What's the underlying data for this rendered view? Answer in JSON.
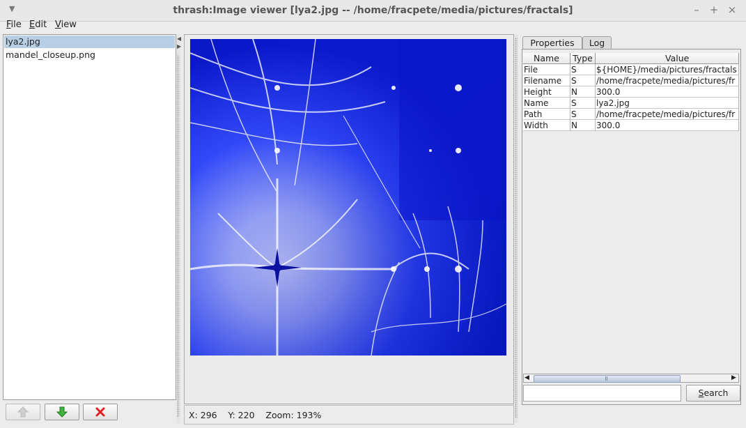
{
  "window": {
    "title": "thrash:Image viewer [lya2.jpg -- /home/fracpete/media/pictures/fractals]",
    "buttons": [
      "–",
      "+",
      "×"
    ]
  },
  "menubar": [
    {
      "accel": "F",
      "rest": "ile"
    },
    {
      "accel": "E",
      "rest": "dit"
    },
    {
      "accel": "V",
      "rest": "iew"
    }
  ],
  "file_list": {
    "items": [
      "lya2.jpg",
      "mandel_closeup.png"
    ],
    "selected_index": 0
  },
  "list_buttons": {
    "move_up_icon": "arrow-up-icon",
    "move_down_icon": "arrow-down-icon",
    "remove_icon": "red-x-icon"
  },
  "image": {
    "file": "lya2.jpg"
  },
  "status": {
    "text": "X: 296    Y: 220    Zoom: 193%"
  },
  "tabs": [
    {
      "label": "Properties",
      "active": true
    },
    {
      "label": "Log",
      "active": false
    }
  ],
  "properties": {
    "columns": [
      "Name",
      "Type",
      "Value"
    ],
    "rows": [
      {
        "name": "File",
        "type": "S",
        "value": "${HOME}/media/pictures/fractals"
      },
      {
        "name": "Filename",
        "type": "S",
        "value": "/home/fracpete/media/pictures/fr"
      },
      {
        "name": "Height",
        "type": "N",
        "value": "300.0"
      },
      {
        "name": "Name",
        "type": "S",
        "value": "lya2.jpg"
      },
      {
        "name": "Path",
        "type": "S",
        "value": "/home/fracpete/media/pictures/fr"
      },
      {
        "name": "Width",
        "type": "N",
        "value": "300.0"
      }
    ]
  },
  "search": {
    "value": "",
    "button_label": "Search",
    "button_accel": "S",
    "button_rest": "earch"
  },
  "colors": {
    "selection": "#b8cfe5",
    "remove_icon": "#e02020",
    "down_icon": "#2a9a2a"
  }
}
